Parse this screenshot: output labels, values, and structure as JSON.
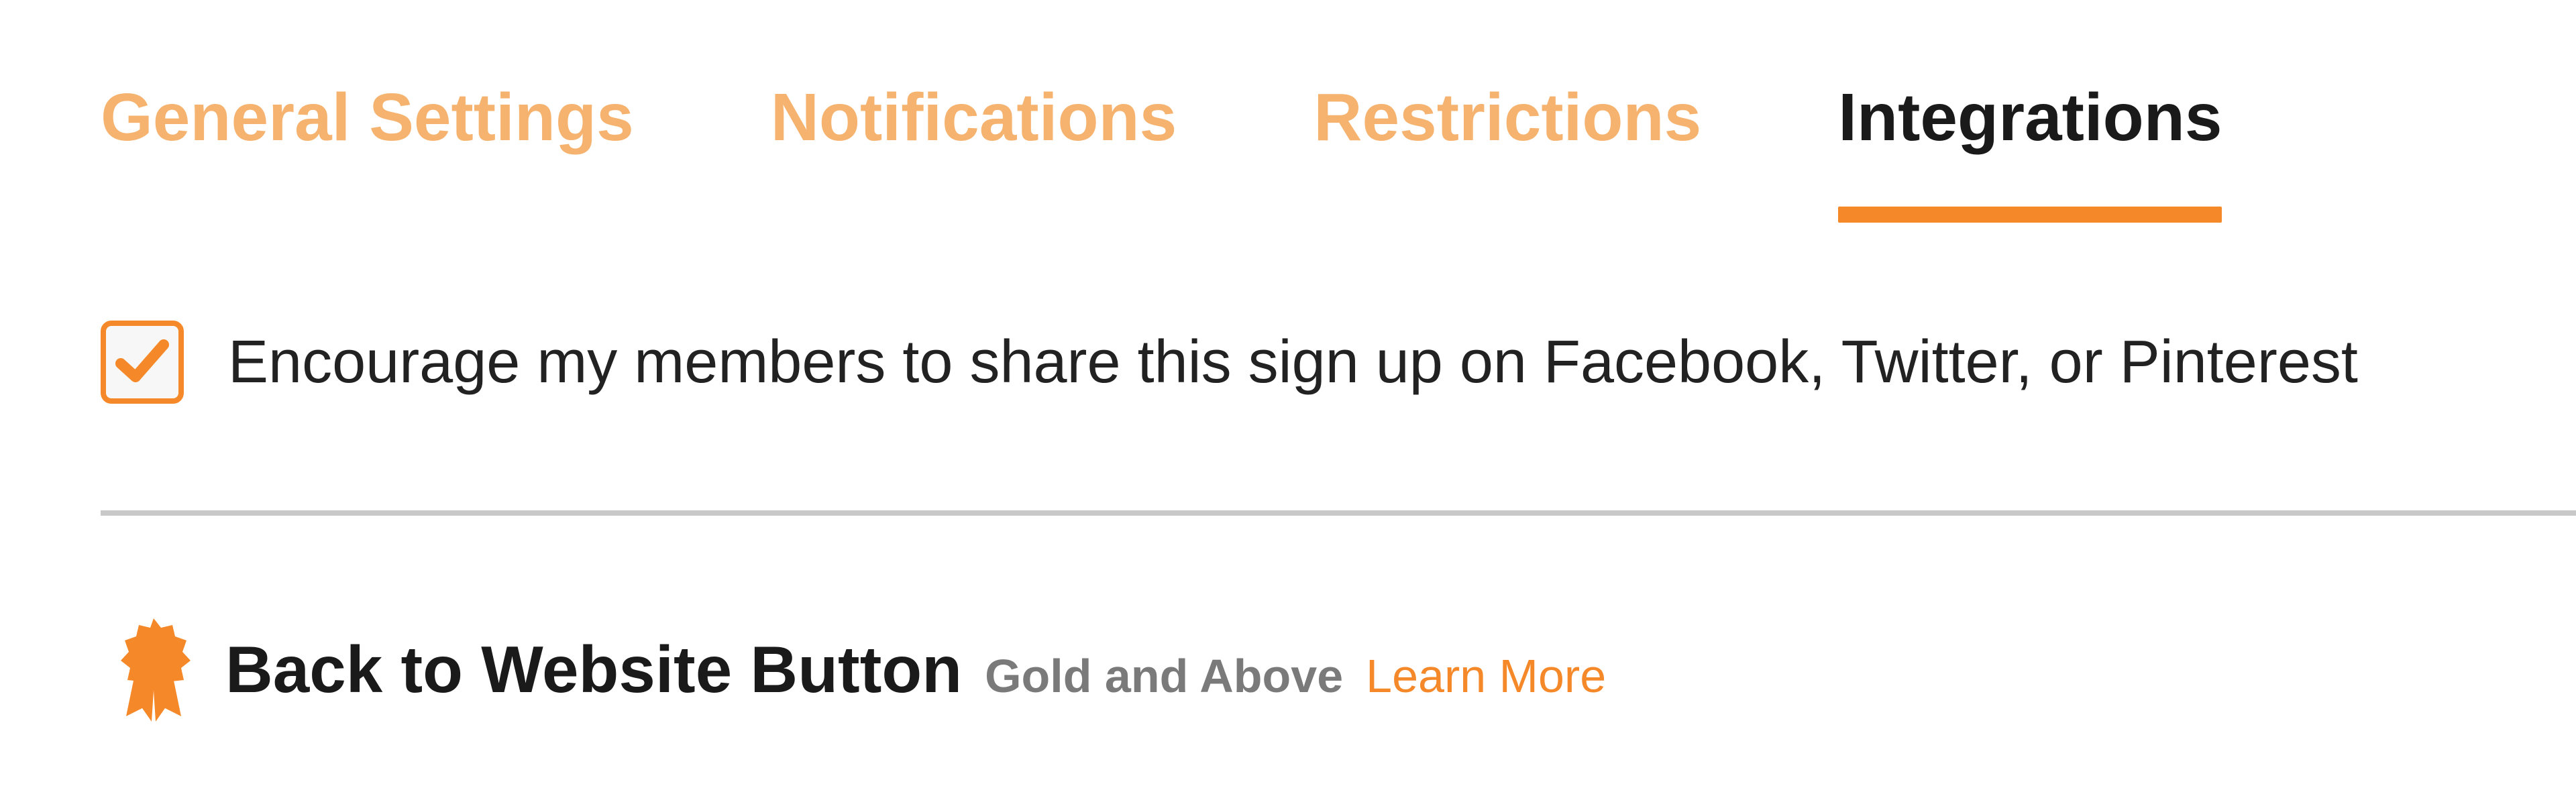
{
  "tabs": [
    {
      "label": "General Settings",
      "active": false
    },
    {
      "label": "Notifications",
      "active": false
    },
    {
      "label": "Restrictions",
      "active": false
    },
    {
      "label": "Integrations",
      "active": true
    }
  ],
  "share": {
    "checked": true,
    "label": "Encourage my members to share this sign up on Facebook, Twitter, or Pinterest"
  },
  "feature": {
    "icon": "award-badge-icon",
    "title": "Back to Website Button",
    "tier": "Gold and Above",
    "learn_more": "Learn More"
  },
  "colors": {
    "accent": "#f5892a",
    "inactive_tab": "#f6b36f",
    "text": "#1a1a1a",
    "muted": "#7a7a7a",
    "divider": "#c8c8c8"
  }
}
